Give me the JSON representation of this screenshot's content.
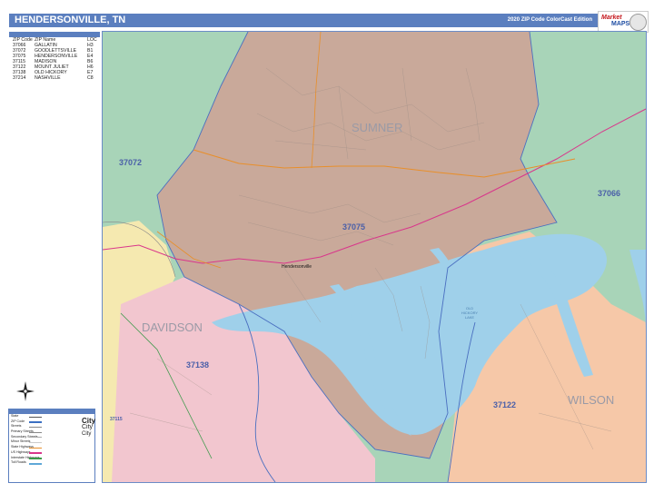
{
  "header": {
    "title": "HENDERSONVILLE, TN",
    "edition": "2020 ZIP Code ColorCast Edition",
    "logo_word1": "Market",
    "logo_word2": "MAPS"
  },
  "zip_index": {
    "columns": [
      "ZIP Code",
      "ZIP Name",
      "LOC"
    ],
    "rows": [
      {
        "zip": "37066",
        "name": "GALLATIN",
        "loc": "H3"
      },
      {
        "zip": "37072",
        "name": "GOODLETTSVILLE",
        "loc": "B1"
      },
      {
        "zip": "37075",
        "name": "HENDERSONVILLE",
        "loc": "E4"
      },
      {
        "zip": "37115",
        "name": "MADISON",
        "loc": "B6"
      },
      {
        "zip": "37122",
        "name": "MOUNT JULIET",
        "loc": "H6"
      },
      {
        "zip": "37138",
        "name": "OLD HICKORY",
        "loc": "E7"
      },
      {
        "zip": "37214",
        "name": "NASHVILLE",
        "loc": "C8"
      }
    ]
  },
  "legend": {
    "rows": [
      "State",
      "ZIP Code",
      "Streets",
      "Primary Streets",
      "Secondary Streets",
      "Minor Streets",
      "State Highways",
      "US Highways",
      "Interstate Highways",
      "Toll Roads"
    ],
    "city_big": "City",
    "city_mid": "City",
    "city_small": "City"
  },
  "map": {
    "counties": {
      "sumner": "SUMNER",
      "davidson": "DAVIDSON",
      "wilson": "WILSON"
    },
    "zips": {
      "z37072": "37072",
      "z37075": "37075",
      "z37066": "37066",
      "z37138": "37138",
      "z37122": "37122",
      "z37115": "37115"
    },
    "city": "Hendersonville",
    "lake": "OLD HICKORY LAKE"
  },
  "colors": {
    "header": "#5b7fbf",
    "zip_37075": "#c9a99a",
    "zip_37072": "#a8d4b8",
    "zip_37066": "#a8d4b8",
    "zip_37138": "#f2c6cf",
    "zip_37122": "#f6c8a8",
    "zip_37214": "#f5e9b0",
    "water": "#9fd0ea"
  }
}
